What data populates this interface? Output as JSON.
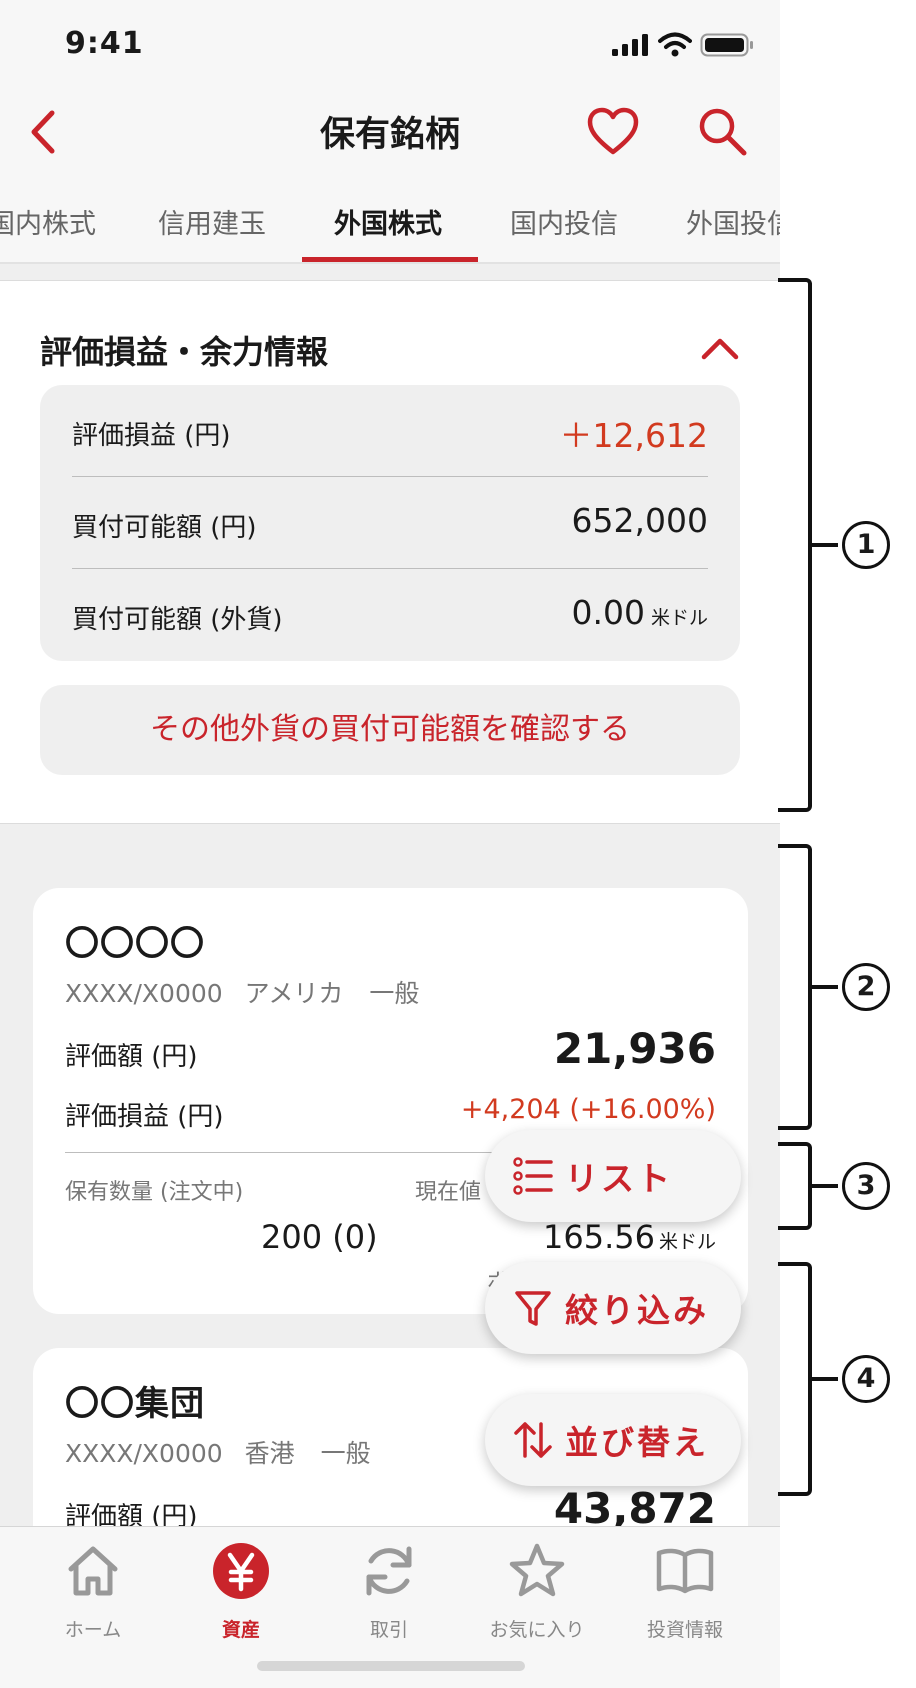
{
  "status_bar": {
    "time": "9:41",
    "icons": [
      "signal-icon",
      "wifi-icon",
      "battery-icon"
    ]
  },
  "nav": {
    "title": "保有銘柄",
    "back_icon": "chevron-left-icon",
    "favorite_icon": "heart-icon",
    "search_icon": "search-icon"
  },
  "tabs": [
    {
      "label": "国内株式"
    },
    {
      "label": "信用建玉"
    },
    {
      "label": "外国株式",
      "active": true
    },
    {
      "label": "国内投信"
    },
    {
      "label": "外国投信"
    }
  ],
  "summary": {
    "title": "評価損益・余力情報",
    "rows": [
      {
        "label": "評価損益 (円)",
        "value": "＋12,612",
        "unit": ""
      },
      {
        "label": "買付可能額 (円)",
        "value": "652,000",
        "unit": ""
      },
      {
        "label": "買付可能額 (外貨)",
        "value": "0.00",
        "unit": "米ドル"
      }
    ],
    "confirm_label": "その他外貨の買付可能額を確認する"
  },
  "holdings": [
    {
      "name": "〇〇〇〇",
      "code": "XXXX/X0000",
      "market": "アメリカ",
      "account": "一般",
      "valuation_label": "評価額 (円)",
      "valuation": "21,936",
      "pl_label": "評価損益 (円)",
      "pl": "+4,204 (+16.00%)",
      "qty_label": "保有数量 (注文中)",
      "qty": "200 (0)",
      "price_label": "現在値",
      "price": "165.56",
      "price_unit": "米ドル",
      "note": "ボ"
    },
    {
      "name": "〇〇集団",
      "code": "XXXX/X0000",
      "market": "香港",
      "account": "一般",
      "valuation_label": "評価額 (円)",
      "valuation": "43,872"
    }
  ],
  "fabs": [
    {
      "label": "リスト",
      "icon": "list-icon"
    },
    {
      "label": "絞り込み",
      "icon": "filter-icon"
    },
    {
      "label": "並び替え",
      "icon": "sort-icon"
    }
  ],
  "bottom_nav": [
    {
      "label": "ホーム",
      "icon": "home-icon"
    },
    {
      "label": "資産",
      "icon": "yen-icon",
      "active": true
    },
    {
      "label": "取引",
      "icon": "refresh-icon"
    },
    {
      "label": "お気に入り",
      "icon": "star-icon"
    },
    {
      "label": "投資情報",
      "icon": "book-icon"
    }
  ],
  "annotations": [
    "1",
    "2",
    "3",
    "4"
  ],
  "colors": {
    "accent": "#c9242b",
    "gain": "#d23a1f",
    "background": "#efefef"
  }
}
